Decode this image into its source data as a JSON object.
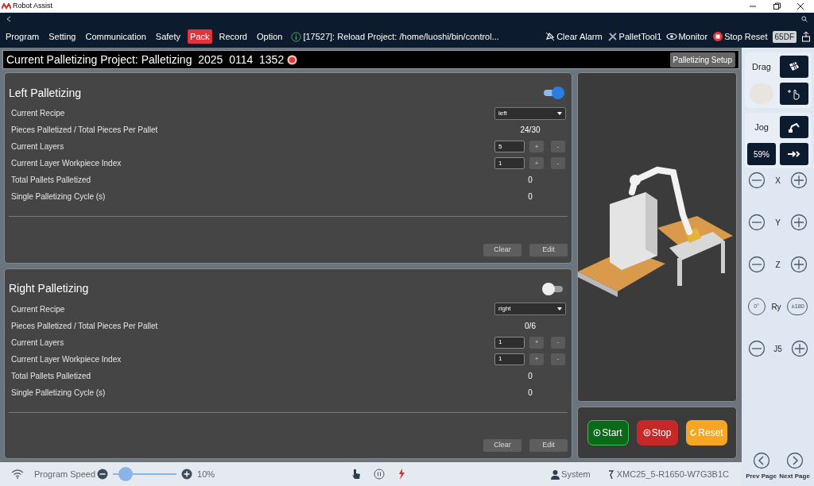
{
  "app_title": "Robot Assist",
  "menu": [
    {
      "label": "Program",
      "selected": false
    },
    {
      "label": "Setting",
      "selected": false
    },
    {
      "label": "Communication",
      "selected": false
    },
    {
      "label": "Safety",
      "selected": false
    },
    {
      "label": "Pack",
      "selected": true
    },
    {
      "label": "Record",
      "selected": false
    },
    {
      "label": "Option",
      "selected": false
    }
  ],
  "status_message": "[17527]: Reload Project: /home/luoshi/bin/control...",
  "toolbar": [
    {
      "kind": "alarm",
      "label": "Clear Alarm"
    },
    {
      "kind": "tool",
      "label": "PalletTool1"
    },
    {
      "kind": "monitor",
      "label": "Monitor"
    },
    {
      "kind": "stop",
      "label": "Stop Reset"
    },
    {
      "kind": "badge",
      "label": "65DF"
    },
    {
      "kind": "upload"
    }
  ],
  "project": {
    "title": "Current Palletizing Project: Palletizing  2025  0114  1352",
    "setup_button": "Palletizing Setup"
  },
  "panels": [
    {
      "title": "Left Palletizing",
      "enabled": true,
      "rows": [
        {
          "kind": "dropdown",
          "label": "Current Recipe",
          "value": "left"
        },
        {
          "kind": "value",
          "label": "Pieces Palletized / Total Pieces Per Pallet",
          "value": "24/30"
        },
        {
          "kind": "stepper",
          "label": "Current Layers",
          "value": "5",
          "plus": "+",
          "minus": "-"
        },
        {
          "kind": "stepper",
          "label": "Current Layer Workpiece Index",
          "value": "1",
          "plus": "+",
          "minus": "-"
        },
        {
          "kind": "value",
          "label": "Total Pallets Palletized",
          "value": "0"
        },
        {
          "kind": "value",
          "label": "Single Palletizing Cycle (s)",
          "value": "0"
        }
      ],
      "buttons": [
        "Clear",
        "Edit"
      ]
    },
    {
      "title": "Right Palletizing",
      "enabled": false,
      "rows": [
        {
          "kind": "dropdown",
          "label": "Current Recipe",
          "value": "right"
        },
        {
          "kind": "value",
          "label": "Pieces Palletized / Total Pieces Per Pallet",
          "value": "0/6"
        },
        {
          "kind": "stepper",
          "label": "Current Layers",
          "value": "1",
          "plus": "+",
          "minus": "-"
        },
        {
          "kind": "stepper",
          "label": "Current Layer Workpiece Index",
          "value": "1",
          "plus": "+",
          "minus": "-"
        },
        {
          "kind": "value",
          "label": "Total Pallets Palletized",
          "value": "0"
        },
        {
          "kind": "value",
          "label": "Single Palletizing Cycle (s)",
          "value": "0"
        }
      ],
      "buttons": [
        "Clear",
        "Edit"
      ]
    }
  ],
  "controls": [
    {
      "kind": "start",
      "label": "Start"
    },
    {
      "kind": "stop",
      "label": "Stop"
    },
    {
      "kind": "reset",
      "label": "Reset"
    }
  ],
  "side": {
    "drag_label": "Drag",
    "jog_label": "Jog",
    "speed": "59%",
    "axes": [
      {
        "kind": "plusminus",
        "label": "X"
      },
      {
        "kind": "plusminus",
        "label": "Y"
      },
      {
        "kind": "plusminus",
        "label": "Z"
      },
      {
        "kind": "angle",
        "label": "Ry",
        "left": "0°",
        "right": "±180"
      },
      {
        "kind": "plusminus",
        "label": "J5"
      }
    ],
    "prev": "Prev Page",
    "next": "Next Page"
  },
  "status_bar": {
    "speed_label": "Program Speed",
    "speed": {
      "level": 0.2
    },
    "speed_value": "10%",
    "user": "System",
    "device": "XMC25_5-R1650-W7G3B1C"
  }
}
